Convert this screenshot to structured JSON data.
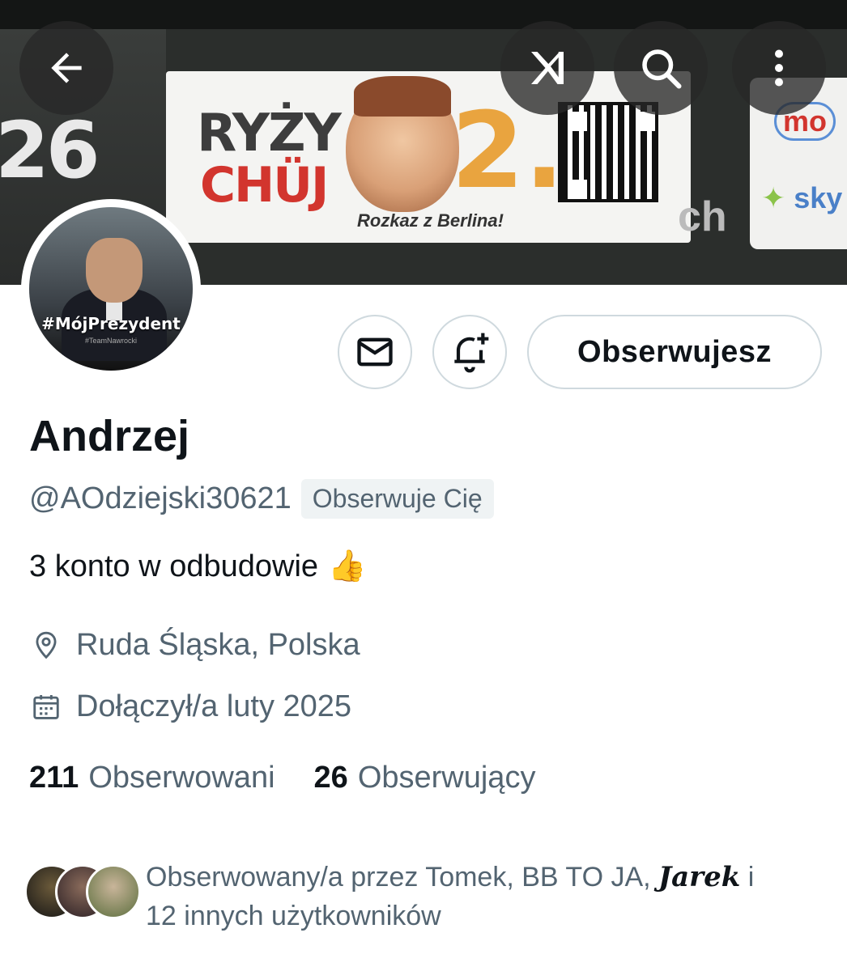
{
  "header": {
    "back_icon": "arrow-left-icon",
    "grok_icon": "grok-icon",
    "search_icon": "search-icon",
    "more_icon": "more-vertical-icon"
  },
  "banner": {
    "left_number": "26",
    "line1": "RYŻY",
    "line2": "CHÜJ",
    "big_number": "2.",
    "subtitle": "Rozkaz z Berlina!",
    "suffix": "ch",
    "right_brand1": "mo",
    "right_brand2": "sky"
  },
  "avatar": {
    "hashtag": "#MójPrezydent",
    "subtag": "#TeamNawrocki"
  },
  "actions": {
    "message_icon": "mail-icon",
    "notify_icon": "bell-plus-icon",
    "follow_label": "Obserwujesz"
  },
  "profile": {
    "name": "Andrzej",
    "handle": "@AOdziejski30621",
    "follows_you": "Obserwuje Cię",
    "bio": "3 konto w odbudowie",
    "bio_emoji": "👍",
    "location": "Ruda Śląska, Polska",
    "joined": "Dołączył/a luty 2025"
  },
  "stats": {
    "following_count": "211",
    "following_label": "Obserwowani",
    "followers_count": "26",
    "followers_label": "Obserwujący"
  },
  "followed_by": {
    "prefix": "Obserwowany/a przez Tomek, BB TO JA,",
    "script_name": "Jarek",
    "conj": "i",
    "suffix": "12 innych użytkowników"
  },
  "colors": {
    "text_primary": "#0f1419",
    "text_secondary": "#536471",
    "border": "#cfd9de",
    "badge_bg": "#eff3f4"
  }
}
